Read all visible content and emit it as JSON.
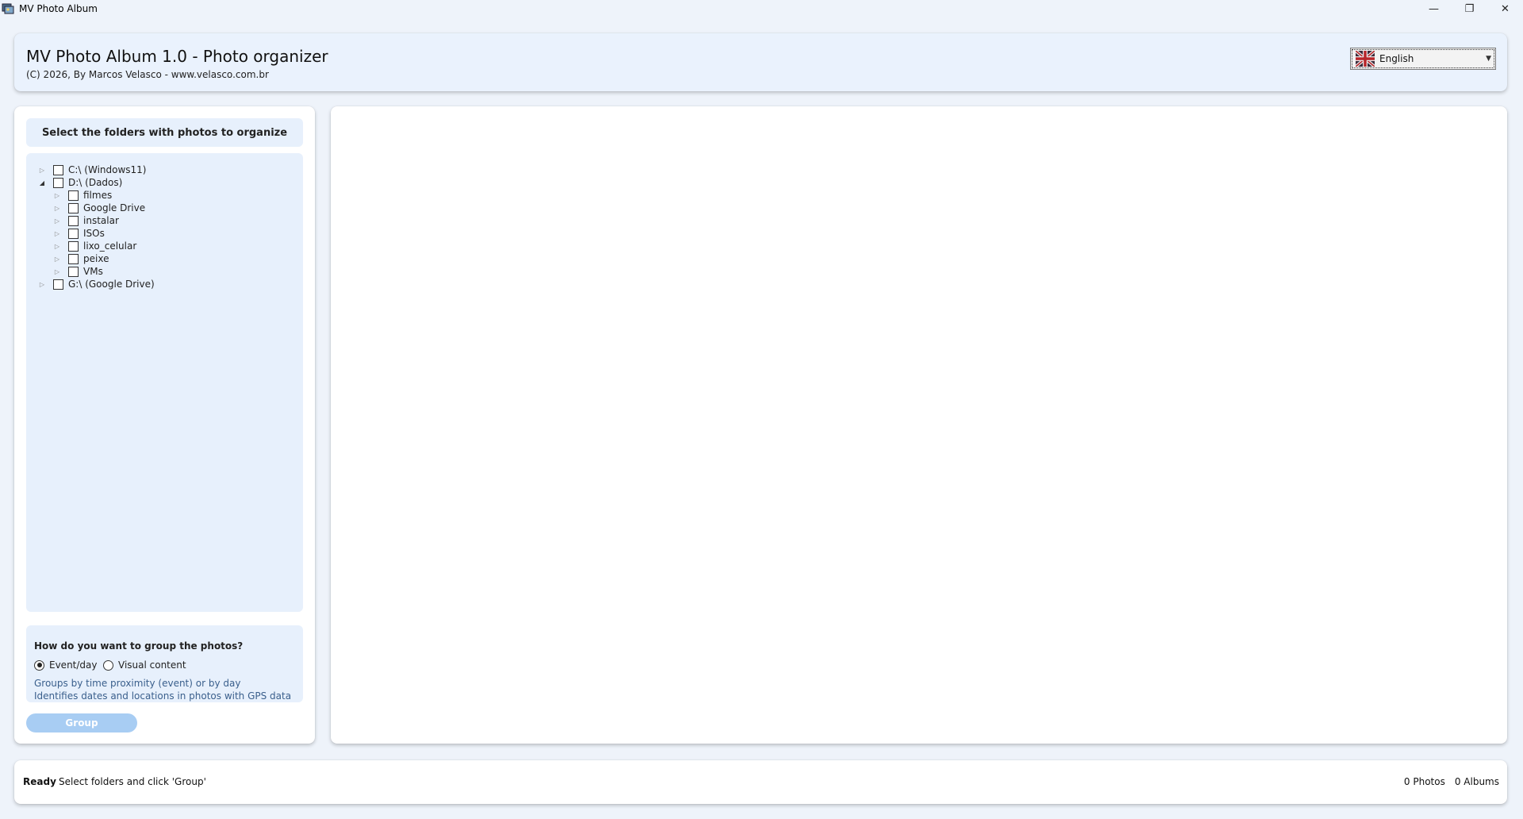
{
  "window": {
    "title": "MV Photo Album",
    "controls": {
      "minimize": "—",
      "maximize": "❐",
      "close": "✕"
    }
  },
  "header": {
    "title": "MV Photo Album 1.0 - Photo organizer",
    "subtitle": "(C) 2026, By Marcos Velasco - www.velasco.com.br",
    "language": {
      "selected": "English",
      "flag_icon": "uk-flag-icon"
    }
  },
  "left_panel": {
    "folders_heading": "Select the folders with photos to organize",
    "tree": [
      {
        "label": "C:\\ (Windows11)",
        "expanded": false,
        "checked": false
      },
      {
        "label": "D:\\ (Dados)",
        "expanded": true,
        "checked": false
      },
      {
        "label": "filmes",
        "expanded": false,
        "checked": false
      },
      {
        "label": "Google Drive",
        "expanded": false,
        "checked": false
      },
      {
        "label": "instalar",
        "expanded": false,
        "checked": false
      },
      {
        "label": "ISOs",
        "expanded": false,
        "checked": false
      },
      {
        "label": "lixo_celular",
        "expanded": false,
        "checked": false
      },
      {
        "label": "peixe",
        "expanded": false,
        "checked": false
      },
      {
        "label": "VMs",
        "expanded": false,
        "checked": false
      },
      {
        "label": "G:\\ (Google Drive)",
        "expanded": false,
        "checked": false
      }
    ],
    "group": {
      "question": "How do you want to group the photos?",
      "option_event": "Event/day",
      "option_visual": "Visual content",
      "selected": "event",
      "hint_line1": "Groups by time proximity (event) or by day",
      "hint_line2": "Identifies dates and locations in photos with GPS data"
    },
    "group_button": "Group"
  },
  "status_bar": {
    "state": "Ready",
    "message": "Select folders and click 'Group'",
    "photos": "0 Photos",
    "albums": "0 Albums"
  }
}
